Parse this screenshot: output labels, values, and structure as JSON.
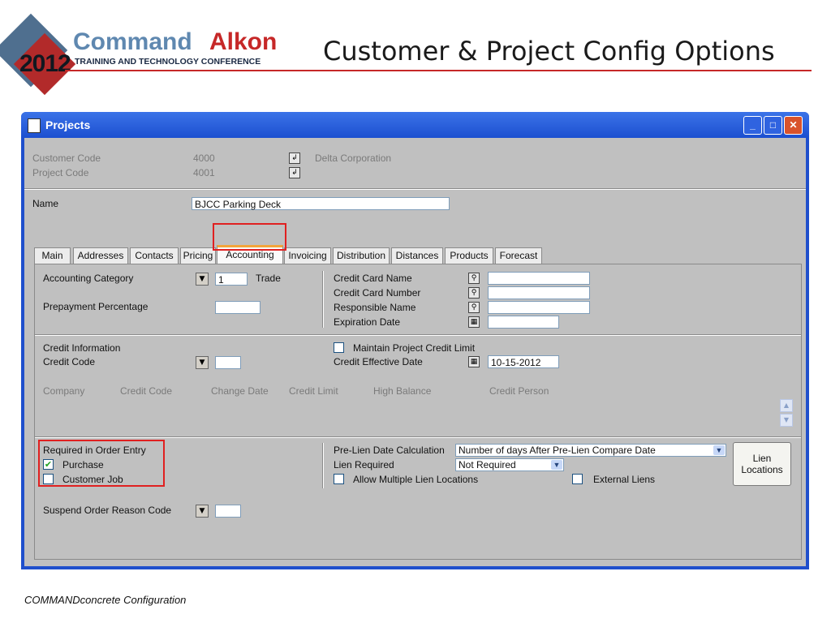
{
  "slide": {
    "logo_year": "2012",
    "logo_word1": "Command",
    "logo_word2": "Alkon",
    "logo_subtitle": "TRAINING AND TECHNOLOGY CONFERENCE",
    "title": "Customer & Project Config Options",
    "footer": "COMMANDconcrete Configuration",
    "accent_color": "#c62828"
  },
  "window": {
    "title": "Projects",
    "controls": [
      "minimize-icon",
      "maximize-icon",
      "close-icon"
    ]
  },
  "header": {
    "customer_code_label": "Customer Code",
    "customer_code_value": "4000",
    "customer_name": "Delta Corporation",
    "project_code_label": "Project Code",
    "project_code_value": "4001",
    "name_label": "Name",
    "name_value": "BJCC Parking Deck"
  },
  "tabs": [
    {
      "label": "Main"
    },
    {
      "label": "Addresses"
    },
    {
      "label": "Contacts"
    },
    {
      "label": "Pricing"
    },
    {
      "label": "Accounting",
      "active": true
    },
    {
      "label": "Invoicing"
    },
    {
      "label": "Distribution"
    },
    {
      "label": "Distances"
    },
    {
      "label": "Products"
    },
    {
      "label": "Forecast"
    }
  ],
  "accounting": {
    "accounting_category_label": "Accounting Category",
    "accounting_category_value": "1",
    "accounting_category_desc": "Trade",
    "prepayment_label": "Prepayment Percentage",
    "prepayment_value": "",
    "credit_card_name_label": "Credit Card Name",
    "credit_card_number_label": "Credit Card Number",
    "responsible_name_label": "Responsible Name",
    "expiration_date_label": "Expiration Date"
  },
  "credit": {
    "credit_information_label": "Credit Information",
    "credit_code_label": "Credit Code",
    "maintain_limit_label": "Maintain Project Credit Limit",
    "maintain_limit_checked": false,
    "effective_date_label": "Credit Effective Date",
    "effective_date_value": "10-15-2012",
    "columns": [
      "Company",
      "Credit Code",
      "Change Date",
      "Credit Limit",
      "High Balance",
      "Credit Person"
    ]
  },
  "order_entry": {
    "required_label": "Required in Order Entry",
    "purchase_label": "Purchase",
    "purchase_checked": true,
    "customer_job_label": "Customer Job",
    "customer_job_checked": false,
    "suspend_label": "Suspend Order Reason Code"
  },
  "lien": {
    "prelien_calc_label": "Pre-Lien Date Calculation",
    "prelien_calc_value": "Number of days After Pre-Lien Compare Date",
    "lien_required_label": "Lien Required",
    "lien_required_value": "Not Required",
    "allow_multiple_label": "Allow Multiple Lien Locations",
    "allow_multiple_checked": false,
    "external_liens_label": "External Liens",
    "external_liens_checked": false,
    "lien_locations_button": "Lien Locations"
  }
}
